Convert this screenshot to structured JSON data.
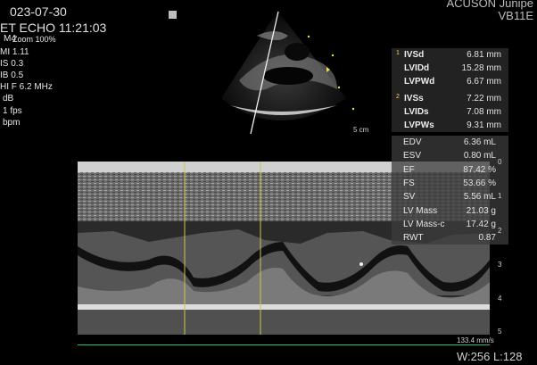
{
  "header": {
    "date": "023-07-30",
    "time_row": "ET ECHO 11:21:03",
    "system_line1": "ACUSON Junipe",
    "system_line2": "VB11E"
  },
  "params": [
    {
      "text": "M4"
    },
    {
      "text": "Zoom 100%"
    },
    {
      "text": "MI 1.11"
    },
    {
      "text": "IS 0.3"
    },
    {
      "text": "IB 0.5"
    },
    {
      "text": "HI F 6.2 MHz"
    },
    {
      "text": "dB"
    },
    {
      "text": "1 fps"
    },
    {
      "text": "bpm"
    }
  ],
  "scale": {
    "label": "5 cm"
  },
  "measurements": [
    {
      "idx": "1",
      "label": "IVSd",
      "value": "6.81 mm"
    },
    {
      "idx": "",
      "label": "LVIDd",
      "value": "15.28 mm"
    },
    {
      "idx": "",
      "label": "LVPWd",
      "value": "6.67 mm"
    },
    {
      "idx": "2",
      "label": "IVSs",
      "value": "7.22 mm"
    },
    {
      "idx": "",
      "label": "LVIDs",
      "value": "7.08 mm"
    },
    {
      "idx": "",
      "label": "LVPWs",
      "value": "9.31 mm"
    }
  ],
  "calculations": [
    {
      "label": "EDV",
      "value": "6.36 mL"
    },
    {
      "label": "ESV",
      "value": "0.80 mL"
    },
    {
      "label": "EF",
      "value": "87.42 %"
    },
    {
      "label": "FS",
      "value": "53.66 %"
    },
    {
      "label": "SV",
      "value": "5.56 mL"
    },
    {
      "label": "LV Mass",
      "value": "21.03 g"
    },
    {
      "label": "LV Mass-c",
      "value": "17.42 g"
    },
    {
      "label": "RWT",
      "value": "0.87"
    }
  ],
  "depth_labels": [
    "0",
    "1",
    "2",
    "3",
    "4",
    "5"
  ],
  "mmode": {
    "sweep_speed": "133.4 mm/s"
  },
  "footer": {
    "window_level": "W:256 L:128"
  },
  "colors": {
    "caliper": "#c8c84a",
    "baseline": "#29c46a",
    "marker": "#f0e040"
  }
}
